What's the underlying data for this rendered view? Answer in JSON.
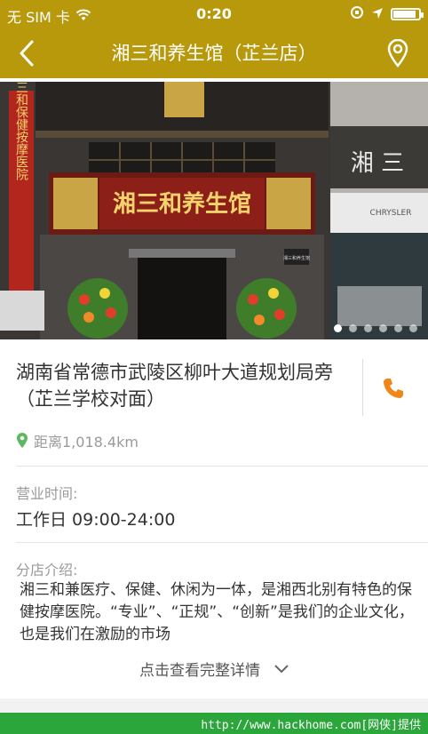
{
  "status_bar": {
    "carrier": "无 SIM 卡",
    "time": "0:20",
    "battery_level": 0.92,
    "icons": [
      "wifi-icon",
      "rotation-lock-icon",
      "location-arrow-icon",
      "battery-icon"
    ]
  },
  "nav": {
    "title": "湘三和养生馆（芷兰店）",
    "back_icon": "chevron-left-icon",
    "location_icon": "map-pin-icon"
  },
  "banner": {
    "sign_text": "湘三和养生馆",
    "side_banner_text": "热烈祝贺湘三和保健按摩医院",
    "right_building_text": "湘 三",
    "right_brand_text": "CHRYSLER",
    "plaque_text": "湘三和养生馆",
    "slide_count": 6,
    "active_slide": 1
  },
  "store": {
    "address": "湖南省常德市武陵区柳叶大道规划局旁（芷兰学校对面）",
    "distance": "距离1,018.4km",
    "phone_icon": "phone-icon",
    "pin_icon": "location-pin-icon"
  },
  "hours": {
    "label": "营业时间:",
    "value": "工作日 09:00-24:00"
  },
  "intro": {
    "label": "分店介绍:",
    "text": "湘三和兼医疗、保健、休闲为一体，是湘西北别有特色的保健按摩医院。“专业”、“正规”、“创新”是我们的企业文化，也是我们在激励的市场",
    "more_label": "点击查看完整详情"
  },
  "watermark": "http://www.hackhome.com[网侠]提供",
  "colors": {
    "gold": "#b8990c",
    "accent_orange": "#f08519",
    "pin_green": "#5cb85c",
    "watermark_green": "#2aa63b"
  }
}
